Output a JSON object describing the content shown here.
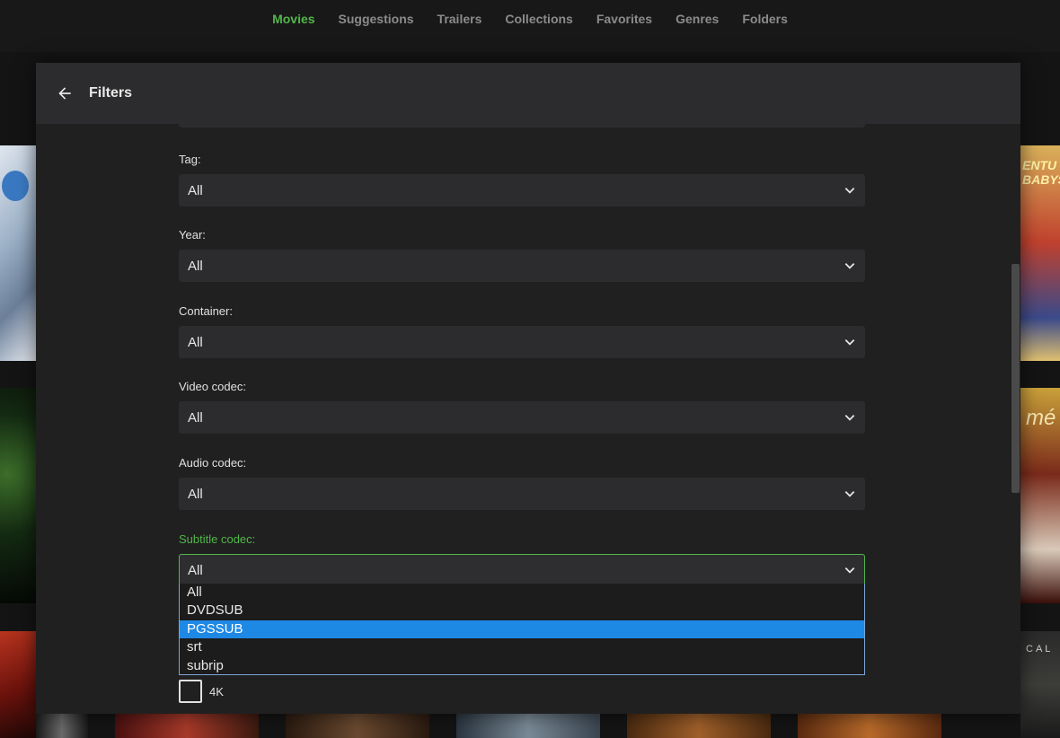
{
  "nav": {
    "tabs": [
      {
        "label": "Movies",
        "active": true
      },
      {
        "label": "Suggestions"
      },
      {
        "label": "Trailers"
      },
      {
        "label": "Collections"
      },
      {
        "label": "Favorites"
      },
      {
        "label": "Genres"
      },
      {
        "label": "Folders"
      }
    ]
  },
  "background": {
    "poster_right1_text": "ENTU BABYSIT",
    "poster_right2_text": "mé",
    "poster_right3_text": "CAL"
  },
  "dialog": {
    "title": "Filters",
    "fields": [
      {
        "label": "Tag:",
        "value": "All"
      },
      {
        "label": "Year:",
        "value": "All"
      },
      {
        "label": "Container:",
        "value": "All"
      },
      {
        "label": "Video codec:",
        "value": "All"
      },
      {
        "label": "Audio codec:",
        "value": "All"
      },
      {
        "label": "Subtitle codec:",
        "value": "All"
      }
    ],
    "subtitle_dropdown": {
      "options": [
        "All",
        "DVDSUB",
        "PGSSUB",
        "srt",
        "subrip"
      ],
      "highlighted": "PGSSUB"
    },
    "checkbox": {
      "label": "4K",
      "checked": false
    }
  },
  "colors": {
    "accent": "#52b54b",
    "highlight": "#1e88e5"
  }
}
